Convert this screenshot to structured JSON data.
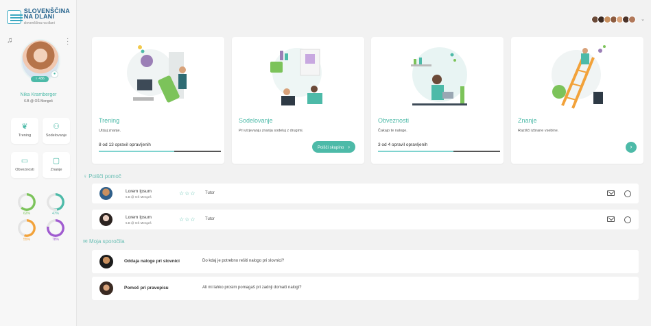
{
  "app": {
    "logo_line1": "SLOVENŠČINA",
    "logo_line2": "NA DLANI",
    "logo_tagline": "slovenščina na dlani"
  },
  "profile": {
    "name": "Nika Kramberger",
    "school": "6.B @ OŠ Mengeš",
    "badge": "436"
  },
  "nav": [
    {
      "label": "Trening",
      "icon": "leaf-icon"
    },
    {
      "label": "Sodelovanje",
      "icon": "people-icon"
    },
    {
      "label": "Obveznosti",
      "icon": "calendar-icon"
    },
    {
      "label": "Znanje",
      "icon": "folder-icon"
    }
  ],
  "gauges": [
    {
      "pct": "62%",
      "value": 0.62,
      "color": "#7cc35a"
    },
    {
      "pct": "47%",
      "value": 0.47,
      "color": "#4dbaa8"
    },
    {
      "pct": "55%",
      "value": 0.55,
      "color": "#f2a23a"
    },
    {
      "pct": "78%",
      "value": 0.78,
      "color": "#a05bd0"
    }
  ],
  "cards": [
    {
      "title": "Trening",
      "desc": "Utrjuj znanje.",
      "progress_text": "8 od 13 opravil opravljenih",
      "progress": 0.62
    },
    {
      "title": "Sodelovanje",
      "desc": "Pri utrjevanju znanja sodeluj z drugimi.",
      "button": "Poišči skupino"
    },
    {
      "title": "Obveznosti",
      "desc": "Čakajo te naloge.",
      "progress_text": "3 od 4 opravil opravljenih",
      "progress": 0.62
    },
    {
      "title": "Znanje",
      "desc": "Razišči izbrane vsebine."
    }
  ],
  "help": {
    "title": "Poišči pomoč",
    "people": [
      {
        "name": "Lorem Ipsum",
        "school": "6.B @ OŠ Mengeš",
        "stars": "☆☆☆",
        "role": "Tutor"
      },
      {
        "name": "Lorem Ipsum",
        "school": "6.B @ OŠ Mengeš",
        "stars": "☆☆☆",
        "role": "Tutor"
      }
    ]
  },
  "messages": {
    "title": "Moja sporočila",
    "items": [
      {
        "subject": "Oddaja naloge pri slovnici",
        "text": "Do kdaj je potrebno rešiti nalogo pri slovnici?"
      },
      {
        "subject": "Pomoč pri pravopisu",
        "text": "Ali mi lahko prosim pomagaš pri zadnji domači nalogi?"
      }
    ]
  }
}
